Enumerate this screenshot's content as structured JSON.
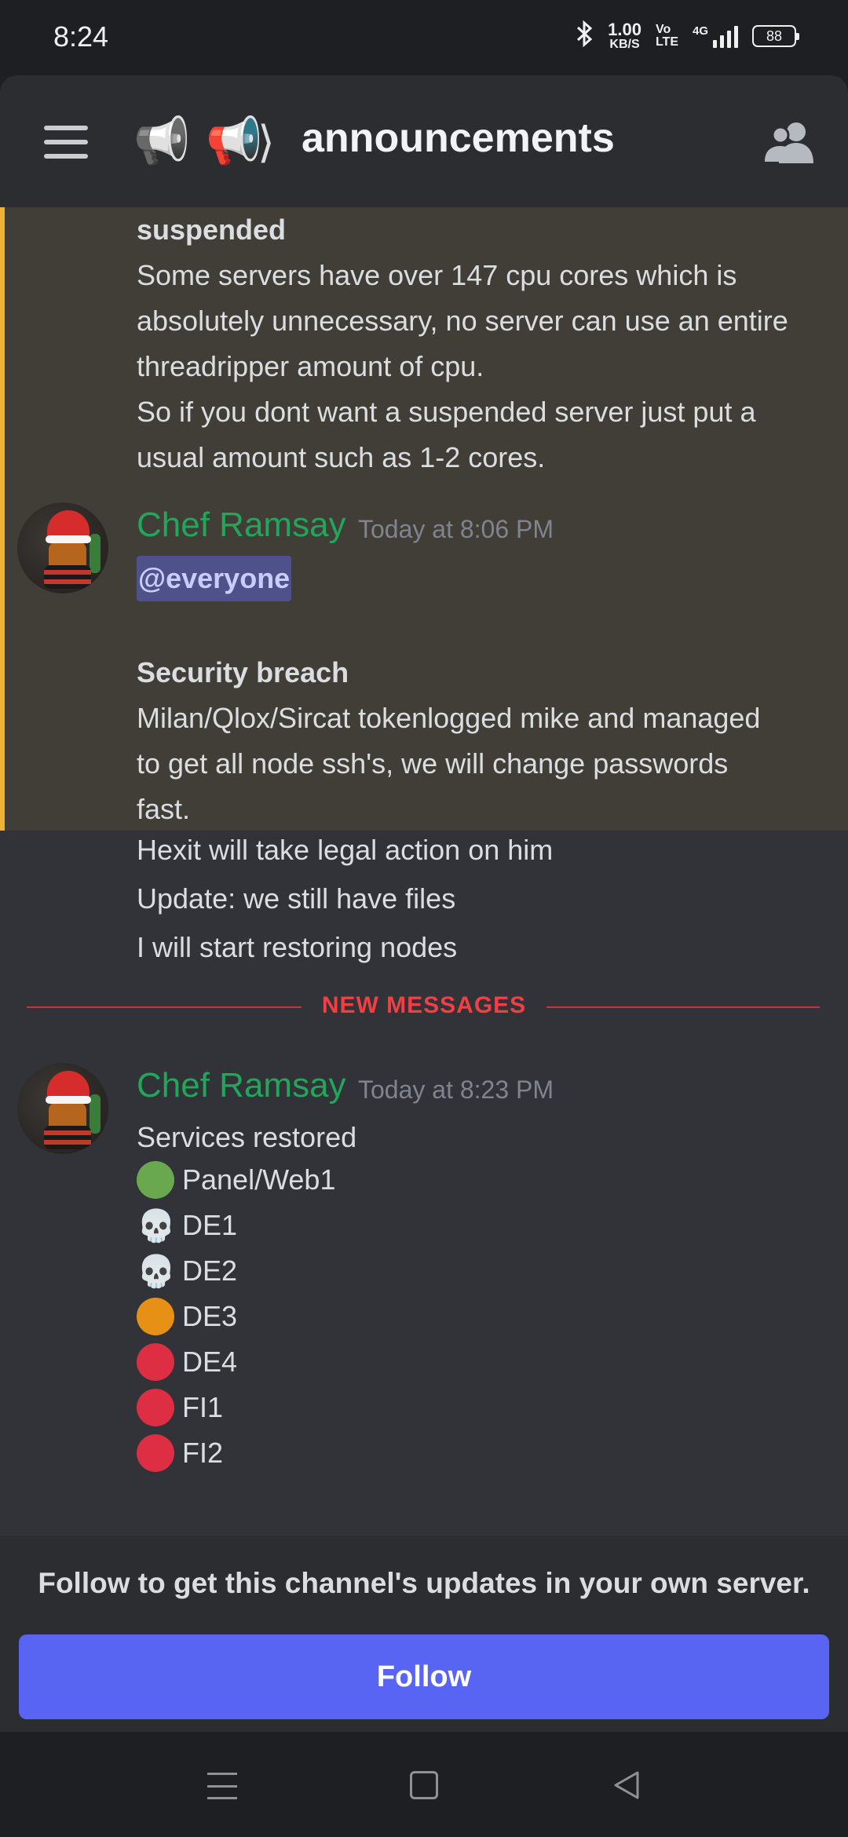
{
  "status_bar": {
    "time": "8:24",
    "net_speed": "1.00",
    "net_unit": "KB/S",
    "volte_top": "Vo",
    "volte_bottom": "LTE",
    "network": "4G",
    "battery": "88"
  },
  "header": {
    "channel_name": "announcements",
    "icons": [
      "menu-icon",
      "megaphone-icon",
      "megaphone-color-icon",
      "members-icon"
    ]
  },
  "messages": {
    "first_block": {
      "heading": "suspended",
      "line1": "Some servers have over 147 cpu cores which is",
      "line2": "absolutely unnecessary, no server can use an entire",
      "line3": "threadripper amount of cpu.",
      "line4": "So if you dont want a suspended server just put a",
      "line5": "usual amount such as 1-2 cores."
    },
    "second": {
      "author": "Chef Ramsay",
      "timestamp": "Today at 8:06 PM",
      "mention": "@everyone",
      "heading": "Security breach",
      "line1": "Milan/Qlox/Sircat tokenlogged mike and managed",
      "line2": "to get all node ssh's, we will change passwords",
      "line3": "fast.",
      "line4": "Hexit will take legal action on him",
      "line5": "Update: we still have files",
      "line6": "I will start restoring nodes"
    },
    "divider": "NEW MESSAGES",
    "third": {
      "author": "Chef Ramsay",
      "timestamp": "Today at 8:23 PM",
      "intro": "Services restored",
      "services": [
        {
          "name": "Panel/Web1",
          "status": "green",
          "color": "#6aa84f"
        },
        {
          "name": "DE1",
          "status": "skull"
        },
        {
          "name": "DE2",
          "status": "skull"
        },
        {
          "name": "DE3",
          "status": "orange",
          "color": "#e69115"
        },
        {
          "name": "DE4",
          "status": "red",
          "color": "#dd2e44"
        },
        {
          "name": "FI1",
          "status": "red",
          "color": "#dd2e44"
        },
        {
          "name": "FI2",
          "status": "red",
          "color": "#dd2e44"
        }
      ]
    }
  },
  "follow": {
    "prompt": "Follow to get this channel's updates in your own server.",
    "button": "Follow"
  },
  "colors": {
    "accent": "#5865f2",
    "author": "#23a55a",
    "highlight_bar": "#f0b232",
    "new_messages": "#f23f43"
  }
}
